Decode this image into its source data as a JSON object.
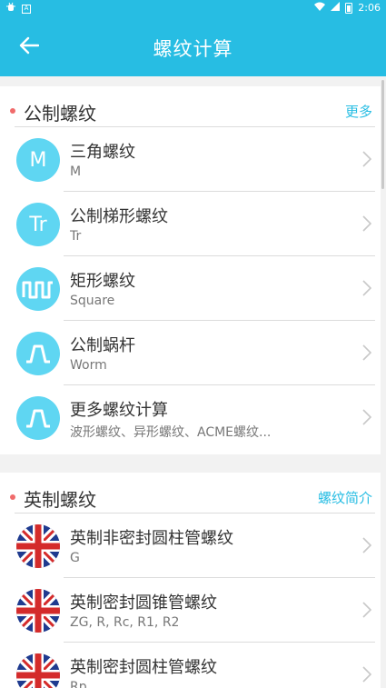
{
  "status_bar": {
    "time": "2:06",
    "app_icon_text": "A"
  },
  "header": {
    "title": "螺纹计算"
  },
  "metric_section": {
    "title": "公制螺纹",
    "link": "更多",
    "items": [
      {
        "icon_text": "M",
        "icon": "m-letter-icon",
        "title": "三角螺纹",
        "subtitle": "M"
      },
      {
        "icon_text": "Tr",
        "icon": "tr-letter-icon",
        "title": "公制梯形螺纹",
        "subtitle": "Tr"
      },
      {
        "icon_text": "",
        "icon": "square-wave-icon",
        "title": "矩形螺纹",
        "subtitle": "Square"
      },
      {
        "icon_text": "",
        "icon": "trapezoid-wave-icon",
        "title": "公制蜗杆",
        "subtitle": "Worm"
      },
      {
        "icon_text": "",
        "icon": "trapezoid-wave-icon",
        "title": "更多螺纹计算",
        "subtitle": "波形螺纹、异形螺纹、ACME螺纹..."
      }
    ]
  },
  "imperial_section": {
    "title": "英制螺纹",
    "link": "螺纹简介",
    "items": [
      {
        "icon": "uk-flag-icon",
        "title": "英制非密封圆柱管螺纹",
        "subtitle": "G"
      },
      {
        "icon": "uk-flag-icon",
        "title": "英制密封圆锥管螺纹",
        "subtitle": "ZG, R, Rc, R1, R2"
      },
      {
        "icon": "uk-flag-icon",
        "title": "英制密封圆柱管螺纹",
        "subtitle": "Rp"
      }
    ]
  },
  "colors": {
    "primary": "#27bde3",
    "avatar": "#5fd6f2",
    "dot": "#f06b6b"
  }
}
